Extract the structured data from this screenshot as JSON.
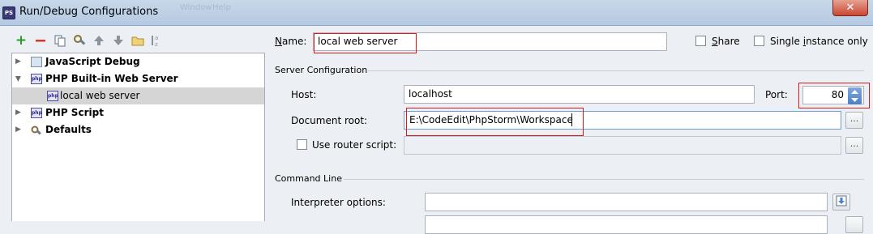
{
  "window": {
    "title": "Run/Debug Configurations",
    "icon_text": "PS",
    "ghost_text_1": "Window",
    "ghost_text_2": "Help",
    "close_symbol": "✕"
  },
  "toolbar": {
    "icons": [
      "add-icon",
      "remove-icon",
      "copy-icon",
      "settings-icon",
      "move-up-icon",
      "move-down-icon",
      "folder-icon",
      "sort-icon"
    ]
  },
  "tree": {
    "items": [
      {
        "label": "JavaScript Debug"
      },
      {
        "label": "PHP Built-in Web Server"
      },
      {
        "label": "local web server"
      },
      {
        "label": "PHP Script"
      },
      {
        "label": "Defaults"
      }
    ]
  },
  "form": {
    "name_label_mnemonic": "N",
    "name_label_rest": "ame:",
    "name_value": "local web server",
    "share_mnemonic": "S",
    "share_rest": "hare",
    "single_pre": "Single ",
    "single_mnemonic": "i",
    "single_post": "nstance only",
    "server_config_title": "Server Configuration",
    "host_label": "Host:",
    "host_value": "localhost",
    "port_label": "Port:",
    "port_value": "80",
    "docroot_label": "Document root:",
    "docroot_value": "E:\\CodeEdit\\PhpStorm\\Workspace",
    "router_label": "Use router script:",
    "router_value": "",
    "browse_symbol": "...",
    "command_line_title": "Command Line",
    "interp_label": "Interpreter options:",
    "interp_value": ""
  },
  "colors": {
    "highlight": "#d91a1a",
    "selection": "#d5d5d5",
    "add": "#2a9c2a",
    "remove": "#d33a2c"
  }
}
